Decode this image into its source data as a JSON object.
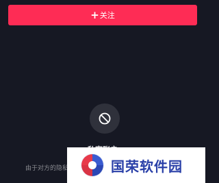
{
  "header": {
    "follow_icon": "plus-icon",
    "follow_label": "关注"
  },
  "empty_state": {
    "icon": "ban-icon",
    "title": "私密账户",
    "description": "由于对方的隐私设置，你无法查看"
  },
  "watermark": {
    "text": "国荣软件园"
  },
  "colors": {
    "background": "#161823",
    "accent": "#fe2c55",
    "watermark_text": "#2a40a8"
  }
}
